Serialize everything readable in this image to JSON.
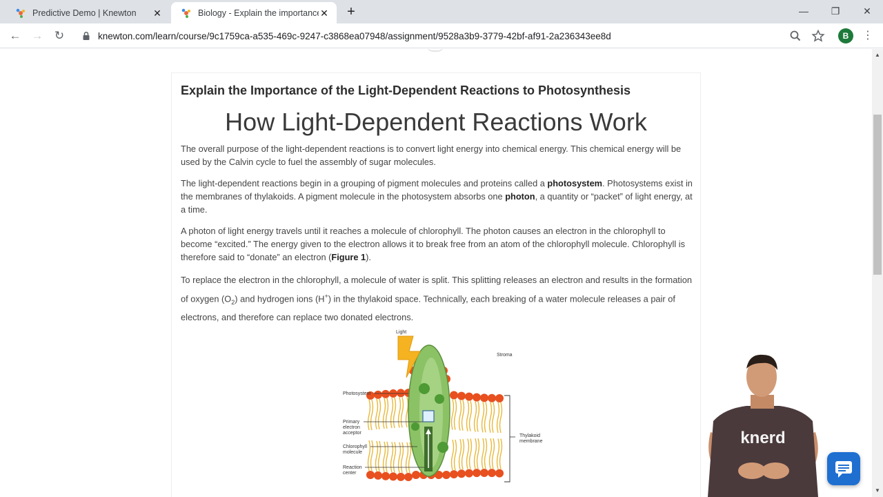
{
  "browser": {
    "tabs": [
      {
        "title": "Predictive Demo | Knewton",
        "active": false
      },
      {
        "title": "Biology - Explain the importance",
        "active": true
      }
    ],
    "url": "knewton.com/learn/course/9c1759ca-a535-469c-9247-c3868ea07948/assignment/9528a3b9-3779-42bf-af91-2a236343ee8d",
    "profile_initial": "B",
    "window_controls": {
      "minimize": "—",
      "restore": "❐",
      "close": "✕"
    }
  },
  "lesson": {
    "assignment_title": "Explain the Importance of the Light-Dependent Reactions to Photosynthesis",
    "section_title": "How Light-Dependent Reactions Work",
    "p1": "The overall purpose of the light-dependent reactions is to convert light energy into chemical energy. This chemical energy will be used by the Calvin cycle to fuel the assembly of sugar molecules.",
    "p2": {
      "a": "The light-dependent reactions begin in a grouping of pigment molecules and proteins called a ",
      "b": "photosystem",
      "c": ". Photosystems exist in the membranes of thylakoids. A pigment molecule in the photosystem absorbs one ",
      "d": "photon",
      "e": ", a quantity or “packet” of light energy, at a time."
    },
    "p3": {
      "a": "A photon of light energy travels until it reaches a molecule of chlorophyll. The photon causes an electron in the chlorophyll to become “excited.” The energy given to the electron allows it to break free from an atom of the chlorophyll molecule. Chlorophyll is therefore said to “donate” an electron (",
      "b": "Figure 1",
      "c": ")."
    },
    "p4": {
      "a": "To replace the electron in the chlorophyll, a molecule of water is split. This splitting releases an electron and results in the formation of oxygen (O",
      "sub": "2",
      "b": ") and hydrogen ions (H",
      "sup": "+",
      "c": ") in the thylakoid space. Technically, each breaking of a water molecule releases a pair of electrons, and therefore can replace two donated electrons."
    },
    "figure_labels": {
      "light": "Light",
      "stroma": "Stroma",
      "photosystem": "Photosystem",
      "primary": [
        "Primary",
        "electron",
        "acceptor"
      ],
      "chlorophyll": [
        "Chlorophyll",
        "molecule"
      ],
      "reaction": [
        "Reaction",
        "center"
      ],
      "thylakoid": [
        "Thylakoid",
        "membrane"
      ]
    }
  },
  "presenter": {
    "shirt_text": "knerd"
  },
  "colors": {
    "accent_blue": "#1f6fd1",
    "lipid_orange": "#e8501f",
    "photosystem_green": "#7dbb57",
    "light_yellow": "#f5b321"
  }
}
